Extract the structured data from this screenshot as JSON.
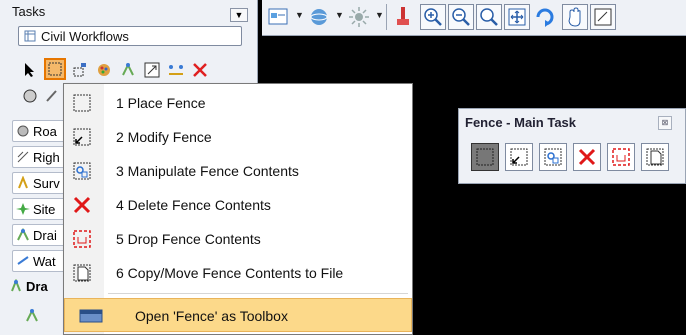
{
  "tasks_panel": {
    "title": "Tasks",
    "current_task": "Civil Workflows",
    "groups": [
      {
        "label": "Roa"
      },
      {
        "label": "Righ"
      },
      {
        "label": "Surv"
      },
      {
        "label": "Site"
      },
      {
        "label": "Drai"
      },
      {
        "label": "Wat"
      },
      {
        "label": "Dra"
      }
    ]
  },
  "toolbox": {
    "title": "Fence - Main Task",
    "close_label": "⊠"
  },
  "menu": {
    "items": [
      {
        "label": "1 Place Fence",
        "icon": "place-fence-icon"
      },
      {
        "label": "2 Modify Fence",
        "icon": "modify-fence-icon"
      },
      {
        "label": "3 Manipulate Fence Contents",
        "icon": "manipulate-fence-icon"
      },
      {
        "label": "4 Delete Fence Contents",
        "icon": "delete-fence-icon"
      },
      {
        "label": "5 Drop Fence Contents",
        "icon": "drop-fence-icon"
      },
      {
        "label": "6 Copy/Move Fence Contents to File",
        "icon": "copy-move-fence-icon"
      }
    ],
    "open_as_toolbox": "Open 'Fence' as Toolbox"
  },
  "colors": {
    "highlight": "#fcd98a",
    "selected_tool": "#f4b86a",
    "background": "#000000",
    "panel": "#eef1f6"
  }
}
